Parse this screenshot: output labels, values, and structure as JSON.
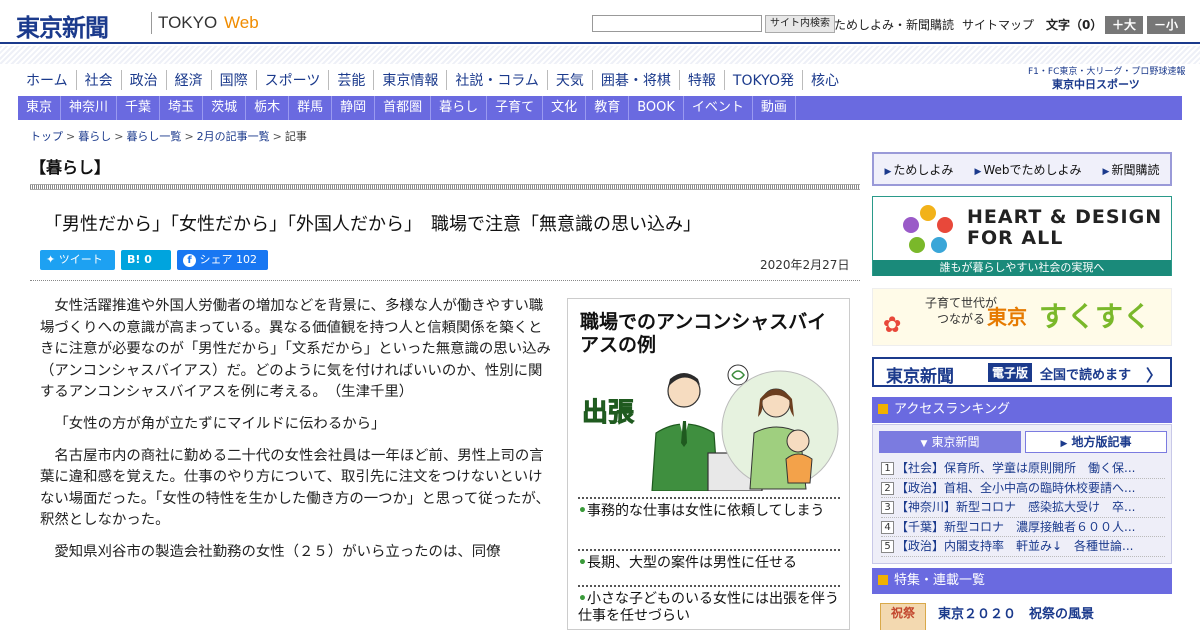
{
  "header": {
    "logo": "東京新聞",
    "logo_tokyo": "TOKYO",
    "logo_web": "Web",
    "search_button": "サイト内検索",
    "link_trial": "ためしよみ・新聞購読",
    "link_sitemap": "サイトマップ",
    "font_label": "文字（0）",
    "font_larger": "＋大",
    "font_smaller": "－小"
  },
  "main_nav": [
    "ホーム",
    "社会",
    "政治",
    "経済",
    "国際",
    "スポーツ",
    "芸能",
    "東京情報",
    "社説・コラム",
    "天気",
    "囲碁・将棋",
    "特報",
    "TOKYO発",
    "核心"
  ],
  "f1_link": "F1・FC東京・大リーグ・プロ野球速報",
  "chunichi_logo": "東京中日スポーツ",
  "sub_nav": [
    "東京",
    "神奈川",
    "千葉",
    "埼玉",
    "茨城",
    "栃木",
    "群馬",
    "静岡",
    "首都圏",
    "暮らし",
    "子育て",
    "文化",
    "教育",
    "BOOK",
    "イベント",
    "動画"
  ],
  "breadcrumb": [
    "トップ",
    "暮らし",
    "暮らし一覧",
    "2月の記事一覧",
    "記事"
  ],
  "section_title": "【暮らし】",
  "article": {
    "headline": "「男性だから」「女性だから」「外国人だから」　職場で注意「無意識の思い込み」",
    "date": "2020年2月27日",
    "share": {
      "tweet": "ツイート",
      "hatena": "B! 0",
      "fb": "シェア 102"
    },
    "paragraphs": [
      "女性活躍推進や外国人労働者の増加などを背景に、多様な人が働きやすい職場づくりへの意識が高まっている。異なる価値観を持つ人と信頼関係を築くときに注意が必要なのが「男性だから」「文系だから」といった無意識の思い込み（アンコンシャスバイアス）だ。どのように気を付ければいいのか、性別に関するアンコンシャスバイアスを例に考える。　（生津千里）",
      "「女性の方が角が立たずにマイルドに伝わるから」",
      "名古屋市内の商社に勤める二十代の女性会社員は一年ほど前、男性上司の言葉に違和感を覚えた。仕事のやり方について、取引先に注文をつけないといけない場面だった。「女性の特性を生かした働き方の一つか」と思って従ったが、釈然としなかった。",
      "愛知県刈谷市の製造会社勤務の女性（２５）がいら立ったのは、同僚"
    ]
  },
  "figure": {
    "title": "職場でのアンコンシャスバイアスの例",
    "illust_text": "出張",
    "items": [
      "事務的な仕事は女性に依頼してしまう",
      "長期、大型の案件は男性に任せる",
      "小さな子どものいる女性には出張を伴う仕事を任せづらい"
    ]
  },
  "sidebar": {
    "links": [
      "ためしよみ",
      "Webでためしよみ",
      "新聞購読"
    ],
    "hd_title_1": "HEART & DESIGN",
    "hd_title_2": "FOR ALL",
    "hd_sub": "誰もが暮らしやすい社会の実現へ",
    "suku_text_1": "子育て世代が",
    "suku_text_2": "つながる",
    "suku_tokyo": "東京",
    "suku_main": "すくすく",
    "ep_logo": "東京新聞",
    "ep_badge": "電子版",
    "ep_text": "全国で読めます",
    "ranking_title": "アクセスランキング",
    "rank_tab_tokyo": "東京新聞",
    "rank_tab_local": "地方版記事",
    "ranking": [
      {
        "num": "1",
        "text": "【社会】保育所、学童は原則開所　働く保..."
      },
      {
        "num": "2",
        "text": "【政治】首相、全小中高の臨時休校要請へ..."
      },
      {
        "num": "3",
        "text": "【神奈川】新型コロナ　感染拡大受け　卒..."
      },
      {
        "num": "4",
        "text": "【千葉】新型コロナ　濃厚接触者６００人..."
      },
      {
        "num": "5",
        "text": "【政治】内閣支持率　軒並み↓　各種世論..."
      }
    ],
    "feature_title": "特集・連載一覧",
    "feature_thumb": "祝祭",
    "feature_item": "東京２０２０　祝祭の風景"
  },
  "colors": {
    "brand": "#1b3a8c",
    "nav": "#6a6ae0",
    "accent": "#f08c00"
  }
}
